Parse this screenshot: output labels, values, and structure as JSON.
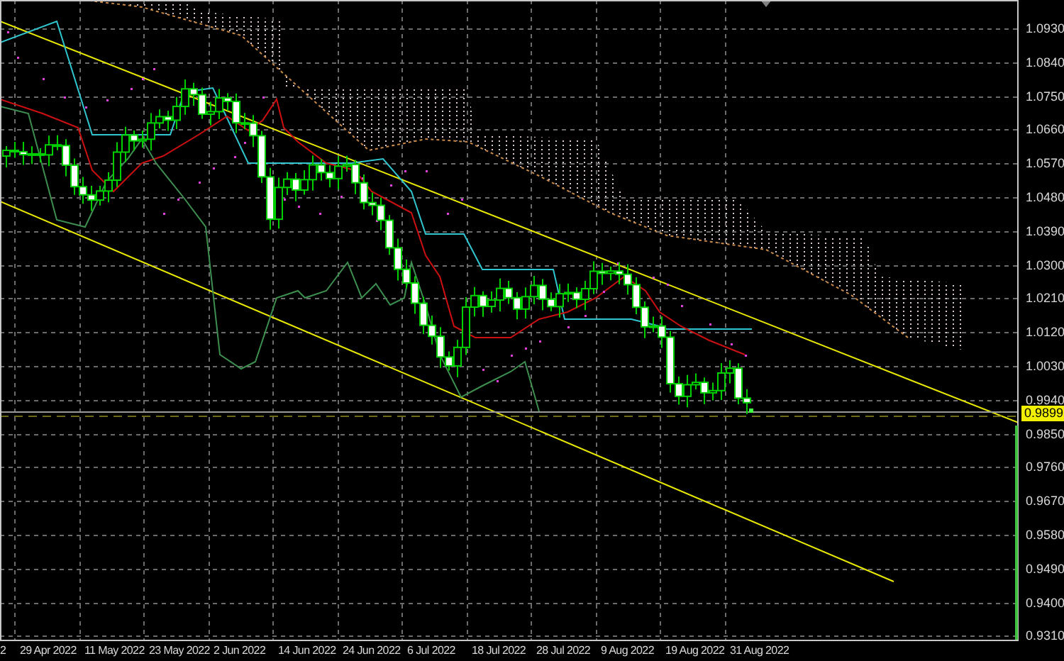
{
  "chart": {
    "price_axis": {
      "labels": [
        "1.0930",
        "1.0840",
        "1.0750",
        "1.0660",
        "1.0570",
        "1.0480",
        "1.0390",
        "1.0300",
        "1.0210",
        "1.0120",
        "1.0030",
        "0.9940",
        "0.9850",
        "0.9760",
        "0.9670",
        "0.9580",
        "0.9490",
        "0.9400",
        "0.9310"
      ]
    },
    "current_price": "0.9899",
    "date_axis": {
      "labels": [
        "2",
        "29 Apr 2022",
        "11 May 2022",
        "23 May 2022",
        "2 Jun 2022",
        "14 Jun 2022",
        "24 Jun 2022",
        "6 Jul 2022",
        "18 Jul 2022",
        "28 Jul 2022",
        "9 Aug 2022",
        "19 Aug 2022",
        "31 Aug 2022"
      ]
    }
  }
}
